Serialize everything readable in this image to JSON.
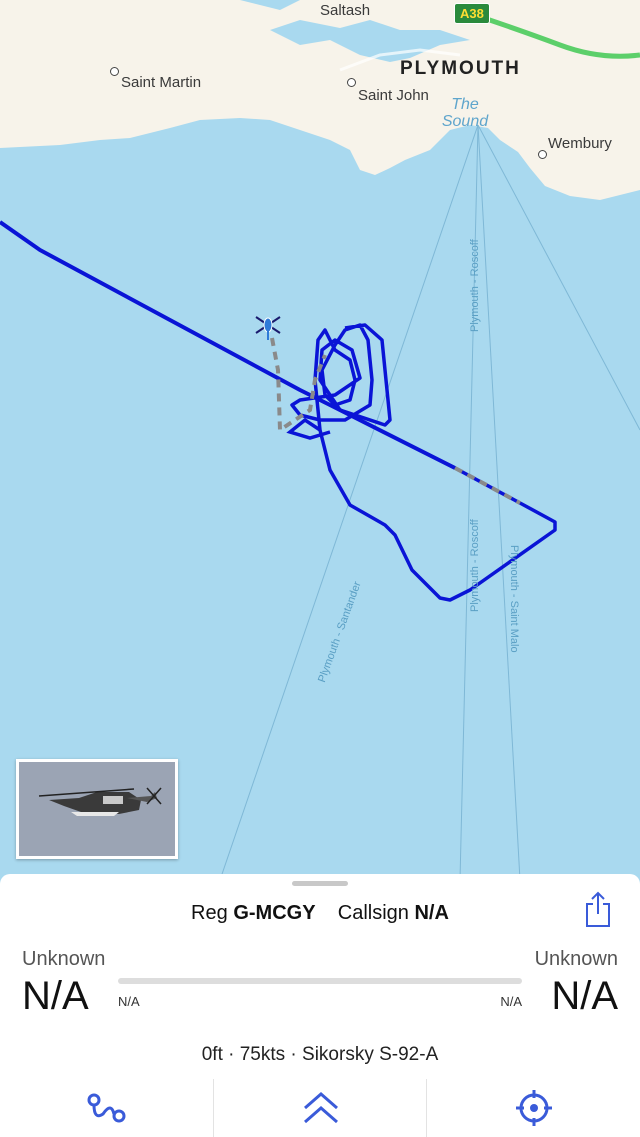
{
  "map": {
    "places": {
      "saltash": "Saltash",
      "plymouth": "PLYMOUTH",
      "saint_martin": "Saint Martin",
      "saint_john": "Saint John",
      "the_sound": "The Sound",
      "wembury": "Wembury",
      "road_shield": "A38"
    },
    "routes": {
      "roscoff_north": "Plymouth - Roscoff",
      "roscoff_south": "Plymouth - Roscoff",
      "santander": "Plymouth - Santander",
      "saint_malo": "Plymouth - Saint Malo"
    },
    "colors": {
      "sea": "#a9d9ef",
      "land": "#f7f3ea",
      "track": "#0a14d6",
      "estimated_track": "#8a8a8a"
    },
    "icons": [
      "helicopter-icon"
    ]
  },
  "aircraft": {
    "reg_label": "Reg",
    "registration": "G-MCGY",
    "callsign_label": "Callsign",
    "callsign": "N/A",
    "origin_name": "Unknown",
    "origin_code": "N/A",
    "origin_time": "N/A",
    "destination_name": "Unknown",
    "destination_code": "N/A",
    "destination_time": "N/A",
    "details": "0ft · 75kts · Sikorsky S-92-A"
  },
  "tabbar": {
    "icons": [
      "route-icon",
      "chevrons-up-icon",
      "crosshair-icon"
    ],
    "accent": "#3a5bd9"
  }
}
